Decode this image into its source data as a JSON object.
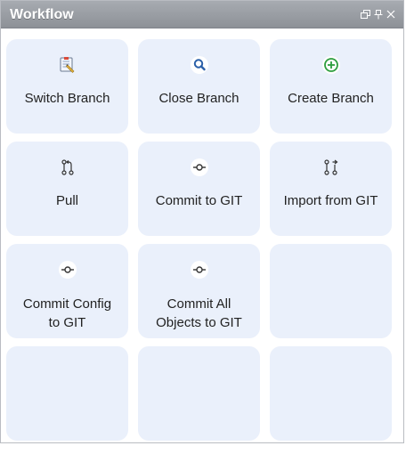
{
  "panel": {
    "title": "Workflow",
    "controls": [
      "restore-icon",
      "pin-icon",
      "close-icon"
    ]
  },
  "tiles": [
    {
      "label": "Switch Branch",
      "icon": "switch-branch-icon"
    },
    {
      "label": "Close Branch",
      "icon": "magnifier-icon"
    },
    {
      "label": "Create Branch",
      "icon": "plus-circle-icon"
    },
    {
      "label": "Pull",
      "icon": "pull-request-icon"
    },
    {
      "label": "Commit to GIT",
      "icon": "commit-icon"
    },
    {
      "label": "Import from GIT",
      "icon": "import-icon"
    },
    {
      "label_line1": "Commit Config",
      "label_line2": "to GIT",
      "icon": "commit-icon"
    },
    {
      "label_line1": "Commit All",
      "label_line2": "Objects to GIT",
      "icon": "commit-icon"
    },
    {
      "label": "",
      "icon": ""
    },
    {
      "label": "",
      "icon": ""
    },
    {
      "label": "",
      "icon": ""
    },
    {
      "label": "",
      "icon": ""
    }
  ],
  "colors": {
    "titlebar": "#9a9ea4",
    "tile_bg": "#eaf0fb",
    "accent_blue": "#2a5fa8",
    "accent_green": "#2e9e3f"
  }
}
